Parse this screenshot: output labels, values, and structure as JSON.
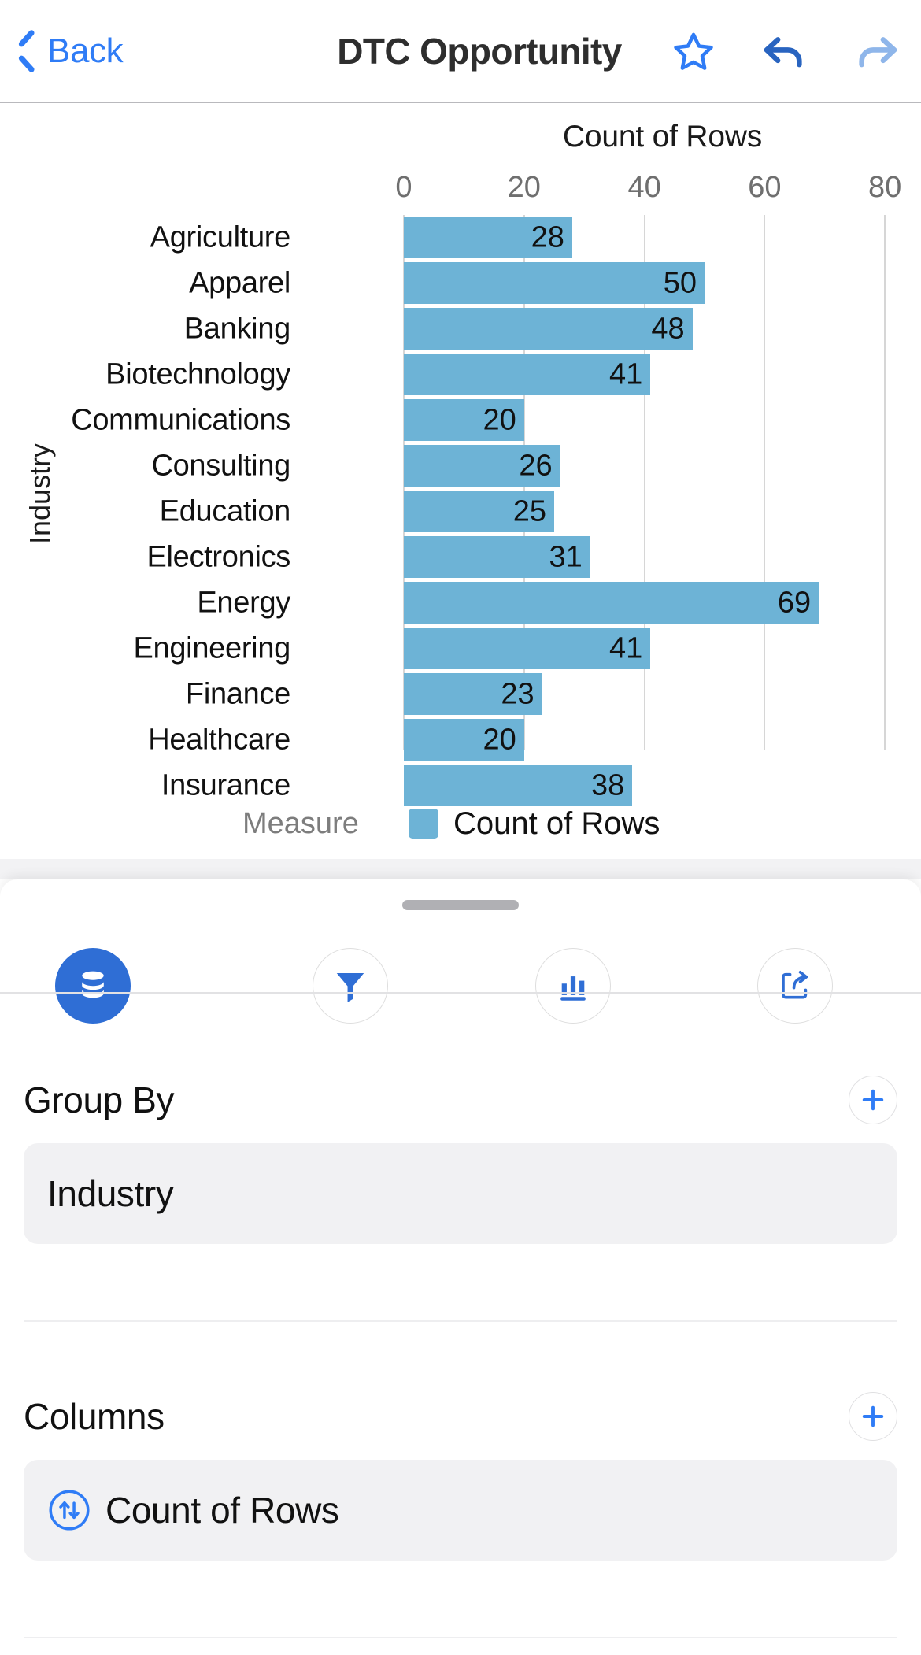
{
  "navbar": {
    "back_label": "Back",
    "title": "DTC Opportunity",
    "back_icon": "chevron-left-icon",
    "favorite_icon": "star-outline-icon",
    "undo_icon": "undo-arrow-icon",
    "redo_icon": "redo-arrow-icon",
    "accent_color": "#2f7cf6",
    "redo_disabled_color": "#8fb6ea"
  },
  "chart_data": {
    "type": "bar",
    "orientation": "horizontal",
    "title": "Count of Rows",
    "xlabel": "Count of Rows",
    "ylabel": "Industry",
    "xlim": [
      0,
      86
    ],
    "xticks": [
      0,
      20,
      40,
      60,
      80
    ],
    "xtick_labels": [
      "0",
      "20",
      "40",
      "60",
      "80"
    ],
    "grid": true,
    "bar_color": "#6db3d6",
    "categories": [
      "Agriculture",
      "Apparel",
      "Banking",
      "Biotechnology",
      "Communications",
      "Consulting",
      "Education",
      "Electronics",
      "Energy",
      "Engineering",
      "Finance",
      "Healthcare",
      "Insurance"
    ],
    "values": [
      28,
      50,
      48,
      41,
      20,
      26,
      25,
      31,
      69,
      41,
      23,
      20,
      38
    ],
    "legend": {
      "caption": "Measure",
      "position": "bottom",
      "entries": [
        {
          "label": "Count of Rows",
          "color": "#6db3d6"
        }
      ]
    },
    "note_truncated_last_row": true
  },
  "sheet": {
    "grabber": "drag-handle",
    "toolbar": [
      {
        "name": "data-source-tab",
        "icon": "database-icon",
        "active": true
      },
      {
        "name": "filter-tab",
        "icon": "filter-funnel-icon",
        "active": false
      },
      {
        "name": "chart-tab",
        "icon": "bar-chart-icon",
        "active": false
      },
      {
        "name": "share-tab",
        "icon": "share-export-icon",
        "active": false
      }
    ],
    "sections": [
      {
        "title": "Group By",
        "add_icon": "plus-icon",
        "items": [
          {
            "label": "Industry",
            "icon": null
          }
        ]
      },
      {
        "title": "Columns",
        "add_icon": "plus-icon",
        "items": [
          {
            "label": "Count of Rows",
            "icon": "sort-arrows-circle-icon"
          }
        ]
      }
    ]
  }
}
